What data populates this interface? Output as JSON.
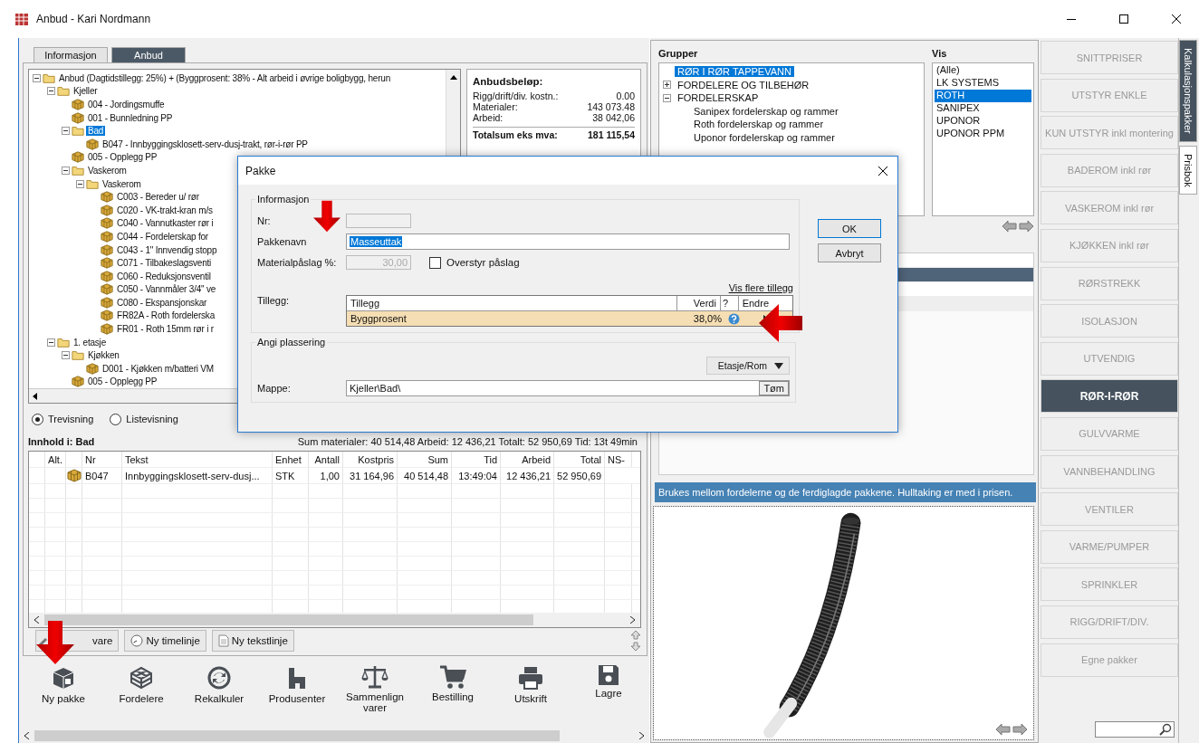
{
  "window": {
    "title": "Anbud - Kari Nordmann"
  },
  "tabs": [
    {
      "label": "Informasjon",
      "selected": false
    },
    {
      "label": "Anbud",
      "selected": true
    }
  ],
  "tree": [
    {
      "label": "Anbud (Dagtidstillegg: 25%) + (Byggprosent: 38% - Alt arbeid i øvrige boligbygg, herun",
      "kind": "folder",
      "selected": false,
      "expanded": true,
      "children": [
        {
          "label": "Kjeller",
          "kind": "folder",
          "selected": false,
          "expanded": true,
          "children": [
            {
              "label": "004 - Jordingsmuffe",
              "kind": "package",
              "selected": false
            },
            {
              "label": "001 - Bunnledning PP",
              "kind": "package",
              "selected": false
            },
            {
              "label": "Bad",
              "kind": "folder",
              "selected": true,
              "expanded": true,
              "children": [
                {
                  "label": "B047 - Innbyggingsklosett-serv-dusj-trakt, rør-i-rør PP",
                  "kind": "package",
                  "selected": false
                }
              ]
            },
            {
              "label": "005 - Opplegg PP",
              "kind": "package",
              "selected": false
            },
            {
              "label": "Vaskerom",
              "kind": "folder",
              "selected": false,
              "expanded": true,
              "children": [
                {
                  "label": "Vaskerom",
                  "kind": "folder",
                  "selected": false,
                  "expanded": true,
                  "children": [
                    {
                      "label": "C003 - Bereder u/ rør",
                      "kind": "package",
                      "selected": false
                    },
                    {
                      "label": "C020 - VK-trakt-kran m/s",
                      "kind": "package",
                      "selected": false
                    },
                    {
                      "label": "C040 - Vannutkaster rør i",
                      "kind": "package",
                      "selected": false
                    },
                    {
                      "label": "C044 - Fordelerskap for",
                      "kind": "package",
                      "selected": false
                    },
                    {
                      "label": "C043 - 1\" Innvendig stopp",
                      "kind": "package",
                      "selected": false
                    },
                    {
                      "label": "C071 - Tilbakeslagsventi",
                      "kind": "package",
                      "selected": false
                    },
                    {
                      "label": "C060 - Reduksjonsventil",
                      "kind": "package",
                      "selected": false
                    },
                    {
                      "label": "C050 - Vannmåler 3/4\" ve",
                      "kind": "package",
                      "selected": false
                    },
                    {
                      "label": "C080 - Ekspansjonskar",
                      "kind": "package",
                      "selected": false
                    },
                    {
                      "label": "FR82A - Roth fordelerska",
                      "kind": "package",
                      "selected": false
                    },
                    {
                      "label": "FR01 - Roth 15mm rør i r",
                      "kind": "package",
                      "selected": false
                    }
                  ]
                }
              ]
            }
          ]
        },
        {
          "label": "1. etasje",
          "kind": "folder",
          "selected": false,
          "expanded": true,
          "children": [
            {
              "label": "Kjøkken",
              "kind": "folder",
              "selected": false,
              "expanded": true,
              "children": [
                {
                  "label": "D001 - Kjøkken m/batteri VM",
                  "kind": "package",
                  "selected": false
                }
              ]
            },
            {
              "label": "005 - Opplegg PP",
              "kind": "package",
              "selected": false
            }
          ]
        }
      ]
    }
  ],
  "summary": {
    "title": "Anbudsbeløp:",
    "rows": [
      {
        "label": "Rigg/drift/div. kostn.:",
        "value": "0.00"
      },
      {
        "label": "Materialer:",
        "value": "143 073.48"
      },
      {
        "label": "Arbeid:",
        "value": "38 042,06"
      }
    ],
    "total_label": "Totalsum eks mva:",
    "total_value": "181 115,54"
  },
  "view_options": [
    {
      "label": "Trevisning",
      "selected": true
    },
    {
      "label": "Listevisning",
      "selected": false
    }
  ],
  "contents": {
    "title": "Innhold i: Bad",
    "totals": "Sum materialer:  40 514,48  Arbeid:  12 436,21 Totalt:  52 950,69 Tid: 13t 49min",
    "columns": [
      "Alt.",
      "Nr",
      "Tekst",
      "Enhet",
      "Antall",
      "Kostpris",
      "Sum",
      "Tid",
      "Arbeid",
      "Total",
      "NS-"
    ],
    "rows": [
      {
        "kind": "package",
        "cells": [
          "",
          "B047",
          "Innbyggingsklosett-serv-dusj...",
          "STK",
          "1,00",
          "31 164,96",
          "40 514,48",
          "13:49:04",
          "12 436,21",
          "52 950,69"
        ]
      }
    ]
  },
  "line_buttons": [
    {
      "label": "vare",
      "kind": "item"
    },
    {
      "label": "Ny timelinje",
      "kind": "time"
    },
    {
      "label": "Ny tekstlinje",
      "kind": "text"
    }
  ],
  "toolbar": [
    {
      "label": "Ny pakke",
      "kind": "box"
    },
    {
      "label": "Fordelere",
      "kind": "cube"
    },
    {
      "label": "Rekalkuler",
      "kind": "refresh"
    },
    {
      "label": "Produsenter",
      "kind": "factory"
    },
    {
      "label": "Sammenlign varer",
      "kind": "scale"
    },
    {
      "label": "Bestilling",
      "kind": "cart"
    },
    {
      "label": "Utskrift",
      "kind": "print"
    },
    {
      "label": "Lagre",
      "kind": "save"
    }
  ],
  "groups": {
    "title": "Grupper",
    "items": [
      {
        "label": "RØR I RØR TAPPEVANN",
        "selected": true
      },
      {
        "label": "FORDELERE OG TILBEHØR",
        "selected": false,
        "expanded": false
      },
      {
        "label": "FORDELERSKAP",
        "selected": false,
        "expanded": true,
        "children": [
          {
            "label": "Sanipex fordelerskap og rammer",
            "selected": false
          },
          {
            "label": "Roth fordelerskap og rammer",
            "selected": false
          },
          {
            "label": "Uponor fordelerskap og rammer",
            "selected": false
          }
        ]
      }
    ]
  },
  "vis": {
    "title": "Vis",
    "items": [
      {
        "label": "(Alle)",
        "selected": false
      },
      {
        "label": "LK SYSTEMS",
        "selected": false
      },
      {
        "label": "ROTH",
        "selected": true
      },
      {
        "label": "SANIPEX",
        "selected": false
      },
      {
        "label": "UPONOR",
        "selected": false
      },
      {
        "label": "UPONOR PPM",
        "selected": false
      }
    ]
  },
  "description": "Brukes mellom fordelerne og de ferdiglagde pakkene. Hulltaking er med i prisen.",
  "categories": [
    {
      "label": "SNITTPRISER",
      "selected": false
    },
    {
      "label": "UTSTYR  ENKLE",
      "selected": false
    },
    {
      "label": "KUN UTSTYR inkl montering",
      "selected": false
    },
    {
      "label": "BADEROM inkl rør",
      "selected": false
    },
    {
      "label": "VASKEROM inkl rør",
      "selected": false
    },
    {
      "label": "KJØKKEN inkl rør",
      "selected": false
    },
    {
      "label": "RØRSTREKK",
      "selected": false
    },
    {
      "label": "ISOLASJON",
      "selected": false
    },
    {
      "label": "UTVENDIG",
      "selected": false
    },
    {
      "label": "RØR-I-RØR",
      "selected": true
    },
    {
      "label": "GULVVARME",
      "selected": false
    },
    {
      "label": "VANNBEHANDLING",
      "selected": false
    },
    {
      "label": "VENTILER",
      "selected": false
    },
    {
      "label": "VARME/PUMPER",
      "selected": false
    },
    {
      "label": "SPRINKLER",
      "selected": false
    },
    {
      "label": "RIGG/DRIFT/DIV.",
      "selected": false
    },
    {
      "label": "Egne pakker",
      "selected": false
    }
  ],
  "side_tabs": [
    {
      "label": "Kalkulasjonspakker",
      "selected": true
    },
    {
      "label": "Prisbok",
      "selected": false
    }
  ],
  "dialog": {
    "title": "Pakke",
    "info_title": "Informasjon",
    "nr_label": "Nr:",
    "name_label": "Pakkenavn",
    "name_value": "Masseuttak",
    "markup_label": "Materialpåslag %:",
    "markup_value": "30,00",
    "override": {
      "label": "Overstyr påslag",
      "checked": false
    },
    "more_link": "Vis flere tillegg",
    "extras_label": "Tillegg:",
    "extras_columns": [
      "Tillegg",
      "Verdi",
      "?",
      "Endre"
    ],
    "extras_rows": [
      {
        "name": "Byggprosent",
        "value": "38,0%"
      }
    ],
    "placement_title": "Angi plassering",
    "floor_button": "Etasje/Rom",
    "folder_label": "Mappe:",
    "folder_value": "Kjeller\\Bad\\",
    "clear_button": "Tøm",
    "ok": "OK",
    "cancel": "Avbryt"
  }
}
